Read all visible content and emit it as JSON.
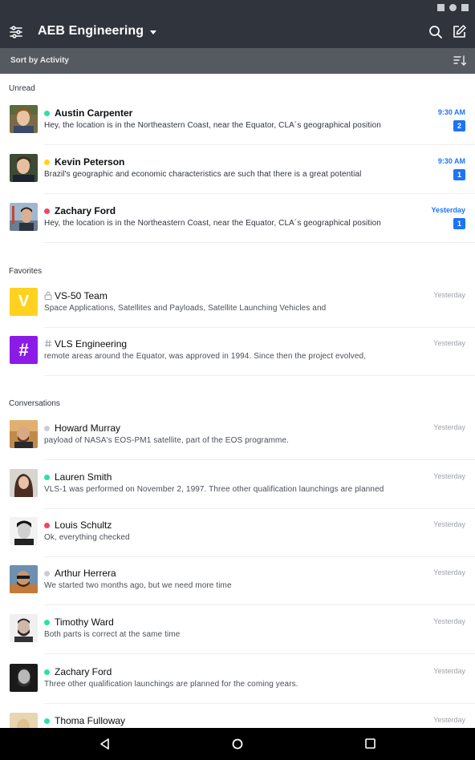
{
  "header": {
    "workspace_title": "AEB Engineering",
    "sort_label": "Sort by Activity"
  },
  "sections": {
    "unread": "Unread",
    "favorites": "Favorites",
    "conversations": "Conversations"
  },
  "unread": [
    {
      "name": "Austin Carpenter",
      "preview": "Hey, the location is in the Northeastern Coast, near the Equator, CLA´s geographical position",
      "time": "9:30 AM",
      "count": "2",
      "status": "online",
      "status_color": "#2de0a5"
    },
    {
      "name": "Kevin Peterson",
      "preview": "Brazil's geographic and economic characteristics are such that there is a great potential",
      "time": "9:30 AM",
      "count": "1",
      "status": "away",
      "status_color": "#ffd21f"
    },
    {
      "name": "Zachary Ford",
      "preview": "Hey, the location is in the Northeastern Coast, near the Equator, CLA´s geographical position",
      "time": "Yesterday",
      "count": "1",
      "status": "busy",
      "status_color": "#f5455c"
    }
  ],
  "favorites": [
    {
      "name": "VS-50 Team",
      "preview": "Space Applications, Satellites and Payloads, Satellite Launching Vehicles and",
      "time": "Yesterday",
      "avatar_letter": "V",
      "avatar_color": "#ffd21f",
      "room_icon": "lock-icon"
    },
    {
      "name": "VLS Engineering",
      "preview": "remote areas around the Equator, was approved in 1994. Since then the project evolved,",
      "time": "Yesterday",
      "avatar_letter": "#",
      "avatar_color": "#8c1be8",
      "room_icon": "hashtag-icon"
    }
  ],
  "conversations": [
    {
      "name": "Howard Murray",
      "preview": "payload of NASA's EOS-PM1 satellite, part of the EOS programme.",
      "time": "Yesterday",
      "status": "offline",
      "status_color": "#cbced1"
    },
    {
      "name": "Lauren Smith",
      "preview": "VLS-1 was performed on November 2, 1997. Three other qualification launchings are planned",
      "time": "Yesterday",
      "status": "online",
      "status_color": "#2de0a5"
    },
    {
      "name": "Louis Schultz",
      "preview": "Ok, everything checked",
      "time": "Yesterday",
      "status": "busy",
      "status_color": "#f5455c"
    },
    {
      "name": "Arthur Herrera",
      "preview": "We started two months ago, but we need more time",
      "time": "Yesterday",
      "status": "offline",
      "status_color": "#cbced1"
    },
    {
      "name": "Timothy Ward",
      "preview": "Both parts is correct at the same time",
      "time": "Yesterday",
      "status": "online",
      "status_color": "#2de0a5"
    },
    {
      "name": "Zachary Ford",
      "preview": "Three other qualification launchings are planned for the coming years.",
      "time": "Yesterday",
      "status": "online",
      "status_color": "#2de0a5"
    },
    {
      "name": "Thoma Fulloway",
      "preview": "",
      "time": "Yesterday",
      "status": "online",
      "status_color": "#2de0a5"
    }
  ],
  "colors": {
    "header_bg": "#2f343d",
    "sortbar_bg": "#555960",
    "accent_blue": "#1d74f5"
  }
}
